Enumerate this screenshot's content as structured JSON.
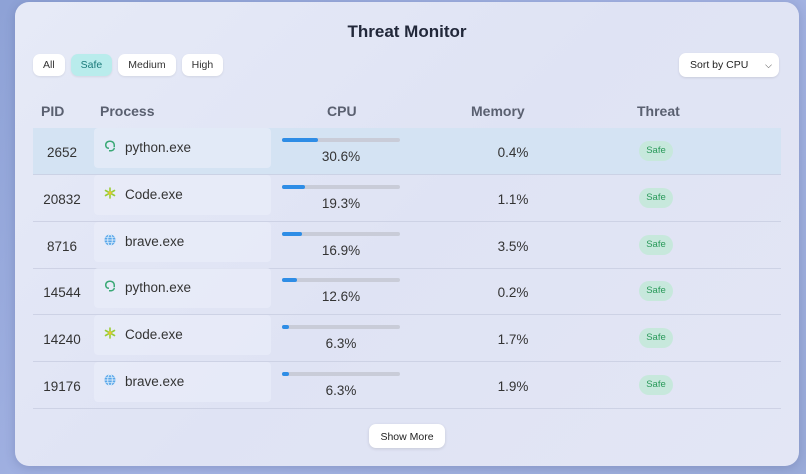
{
  "title": "Threat Monitor",
  "filters": [
    "All",
    "Safe",
    "Medium",
    "High"
  ],
  "active_filter": "Safe",
  "sort": {
    "selected": "Sort by CPU"
  },
  "columns": {
    "pid": "PID",
    "process": "Process",
    "cpu": "CPU",
    "memory": "Memory",
    "threat": "Threat"
  },
  "rows": [
    {
      "pid": "2652",
      "icon": "python-icon",
      "process": "python.exe",
      "cpu": "30.6%",
      "cpu_value": 30.6,
      "memory": "0.4%",
      "threat": "Safe"
    },
    {
      "pid": "20832",
      "icon": "vscode-icon",
      "process": "Code.exe",
      "cpu": "19.3%",
      "cpu_value": 19.3,
      "memory": "1.1%",
      "threat": "Safe"
    },
    {
      "pid": "8716",
      "icon": "globe-icon",
      "process": "brave.exe",
      "cpu": "16.9%",
      "cpu_value": 16.9,
      "memory": "3.5%",
      "threat": "Safe"
    },
    {
      "pid": "14544",
      "icon": "python-icon",
      "process": "python.exe",
      "cpu": "12.6%",
      "cpu_value": 12.6,
      "memory": "0.2%",
      "threat": "Safe"
    },
    {
      "pid": "14240",
      "icon": "vscode-icon",
      "process": "Code.exe",
      "cpu": "6.3%",
      "cpu_value": 6.3,
      "memory": "1.7%",
      "threat": "Safe"
    },
    {
      "pid": "19176",
      "icon": "globe-icon",
      "process": "brave.exe",
      "cpu": "6.3%",
      "cpu_value": 6.3,
      "memory": "1.9%",
      "threat": "Safe"
    }
  ],
  "show_more_label": "Show More",
  "colors": {
    "accent": "#2e8de6",
    "safe_badge": "#c7e8dc",
    "safe_text": "#2a9a5a",
    "active_filter": "#b9ecec"
  }
}
